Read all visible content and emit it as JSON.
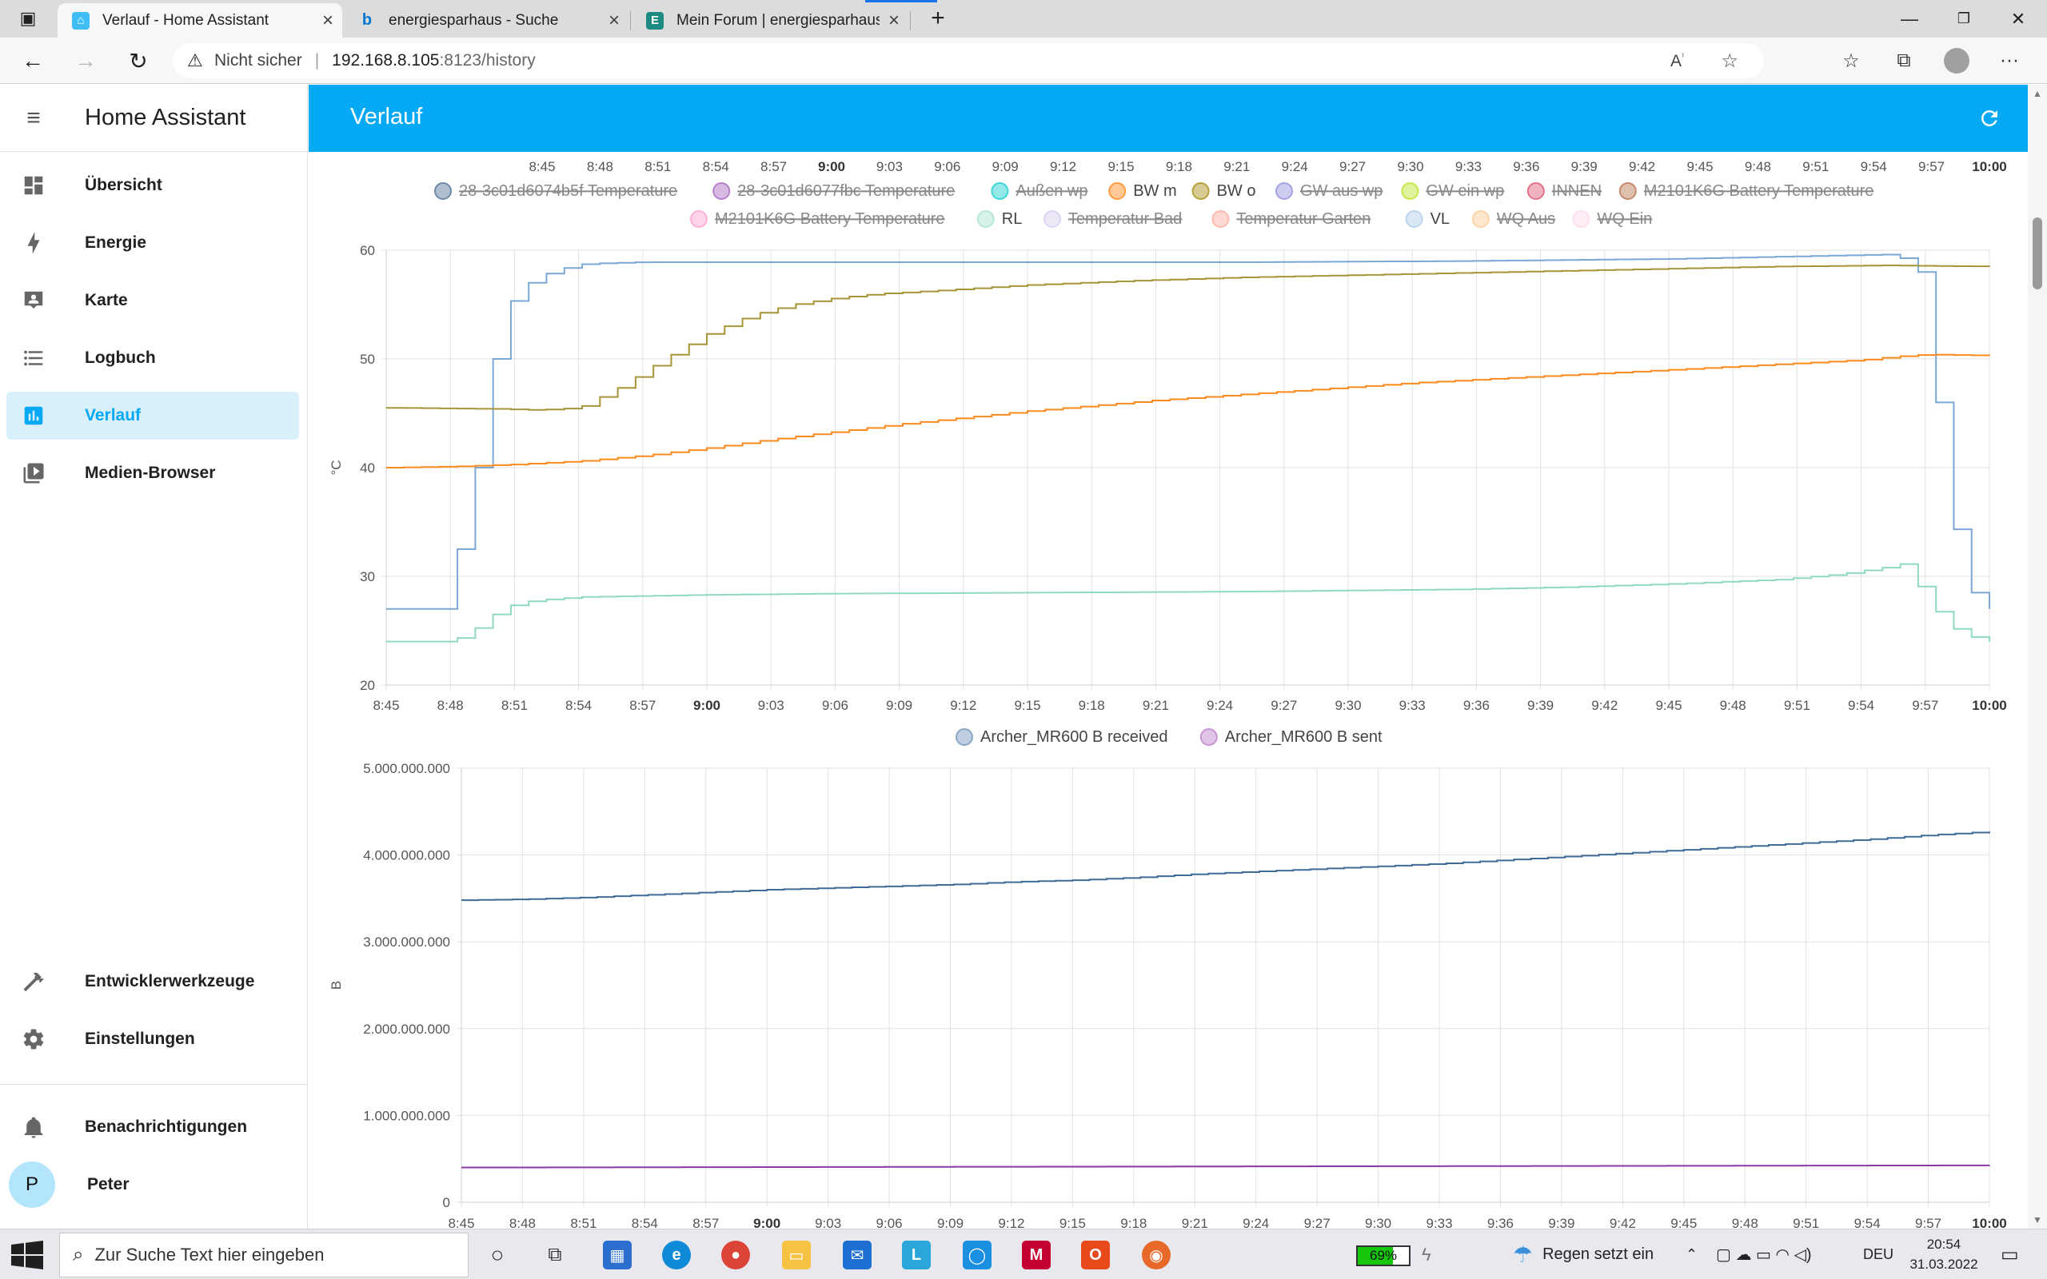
{
  "browser": {
    "tabs": [
      {
        "title": "Verlauf - Home Assistant",
        "icon": "home-assistant-icon",
        "color": "#41bdf5",
        "active": true
      },
      {
        "title": "energiesparhaus - Suche",
        "icon": "bing-icon",
        "color": "#0078d4",
        "active": false
      },
      {
        "title": "Mein Forum | energiesparhaus.at",
        "icon": "forum-e-icon",
        "color": "#1b8a82",
        "active": false
      }
    ],
    "insecure_label": "Nicht sicher",
    "url_host": "192.168.8.105",
    "url_rest": ":8123/history"
  },
  "sidebar": {
    "title": "Home Assistant",
    "items": [
      {
        "label": "Übersicht",
        "icon": "dashboard-icon",
        "selected": false
      },
      {
        "label": "Energie",
        "icon": "lightning-bolt-icon",
        "selected": false
      },
      {
        "label": "Karte",
        "icon": "map-account-icon",
        "selected": false
      },
      {
        "label": "Logbuch",
        "icon": "logbook-list-icon",
        "selected": false
      },
      {
        "label": "Verlauf",
        "icon": "history-chart-icon",
        "selected": true
      },
      {
        "label": "Medien-Browser",
        "icon": "media-play-icon",
        "selected": false
      }
    ],
    "bottom_items": [
      {
        "label": "Entwicklerwerkzeuge",
        "icon": "hammer-icon"
      },
      {
        "label": "Einstellungen",
        "icon": "cog-icon"
      }
    ],
    "notifications_label": "Benachrichtigungen",
    "user": {
      "initial": "P",
      "name": "Peter"
    }
  },
  "header": {
    "title": "Verlauf"
  },
  "chart_data": [
    {
      "type": "line",
      "ylabel": "°C",
      "ylim": [
        20,
        60
      ],
      "yticks": [
        20,
        30,
        40,
        50,
        60
      ],
      "xlim_minutes": [
        0,
        75
      ],
      "x_ticks": [
        "8:45",
        "8:48",
        "8:51",
        "8:54",
        "8:57",
        "9:00",
        "9:03",
        "9:06",
        "9:09",
        "9:12",
        "9:15",
        "9:18",
        "9:21",
        "9:24",
        "9:27",
        "9:30",
        "9:33",
        "9:36",
        "9:39",
        "9:42",
        "9:45",
        "9:48",
        "9:51",
        "9:54",
        "9:57",
        "10:00"
      ],
      "bold_ticks": [
        "9:00",
        "10:00"
      ],
      "legend": [
        {
          "name": "28-3c01d6074b5f Temperature",
          "color": "#6f8aa8",
          "hidden": true
        },
        {
          "name": "28-3c01d6077fbc Temperature",
          "color": "#b77fc9",
          "hidden": true
        },
        {
          "name": "Außen wp",
          "color": "#3ed6d6",
          "hidden": true
        },
        {
          "name": "BW m",
          "color": "#ff9b3d",
          "hidden": false
        },
        {
          "name": "BW o",
          "color": "#b7a13a",
          "hidden": false
        },
        {
          "name": "GW aus wp",
          "color": "#a5a3e3",
          "hidden": true
        },
        {
          "name": "GW ein wp",
          "color": "#c6e84a",
          "hidden": true
        },
        {
          "name": "INNEN",
          "color": "#e3738a",
          "hidden": true
        },
        {
          "name": "M2101K6G Battery Temperature",
          "color": "#c58a6c",
          "hidden": true
        },
        {
          "name": "M2101K6G Battery Temperature",
          "color": "#ffb0d8",
          "hidden": true
        },
        {
          "name": "RL",
          "color": "#b5e8d8",
          "hidden": false
        },
        {
          "name": "Temperatur Bad",
          "color": "#ded6f2",
          "hidden": true
        },
        {
          "name": "Temperatur Garten",
          "color": "#ffb8b0",
          "hidden": true
        },
        {
          "name": "VL",
          "color": "#bcd5ee",
          "hidden": false
        },
        {
          "name": "WQ Aus",
          "color": "#ffd3a8",
          "hidden": true
        },
        {
          "name": "WQ Ein",
          "color": "#ffe0ee",
          "hidden": true
        }
      ],
      "series": [
        {
          "name": "VL",
          "color": "#7aa8d6",
          "x": [
            0,
            2.5,
            3,
            3.5,
            4,
            4.5,
            5,
            5.5,
            6,
            7,
            8,
            9,
            10,
            12,
            15,
            20,
            30,
            40,
            50,
            60,
            65,
            70,
            71.5,
            72,
            72.5,
            73,
            73.5,
            74,
            74.5,
            75
          ],
          "y": [
            27,
            27,
            29.5,
            34,
            38,
            44,
            50,
            54,
            56,
            57.5,
            58.2,
            58.7,
            58.8,
            58.9,
            58.9,
            58.9,
            58.9,
            58.9,
            59,
            59.2,
            59.4,
            59.6,
            59,
            56,
            46,
            37,
            33,
            29,
            27.5,
            27
          ]
        },
        {
          "name": "BW o",
          "color": "#a69437",
          "x": [
            0,
            5,
            7,
            9,
            11,
            13,
            15,
            17,
            19,
            21,
            23,
            25,
            30,
            35,
            40,
            45,
            50,
            55,
            60,
            65,
            70,
            75
          ],
          "y": [
            45.5,
            45.4,
            45.3,
            45.5,
            47.5,
            50,
            52.3,
            54,
            55,
            55.6,
            56,
            56.2,
            56.8,
            57.2,
            57.5,
            57.7,
            57.9,
            58.1,
            58.3,
            58.5,
            58.6,
            58.5
          ]
        },
        {
          "name": "BW m",
          "color": "#fb8a1e",
          "x": [
            0,
            3,
            6,
            9,
            12,
            15,
            18,
            21,
            24,
            27,
            30,
            33,
            36,
            39,
            42,
            45,
            48,
            51,
            54,
            57,
            60,
            63,
            66,
            69,
            70.5,
            72,
            75
          ],
          "y": [
            40,
            40.1,
            40.3,
            40.6,
            41.1,
            41.8,
            42.6,
            43.3,
            44,
            44.6,
            45.2,
            45.7,
            46.2,
            46.6,
            47,
            47.4,
            47.8,
            48.1,
            48.4,
            48.7,
            49,
            49.3,
            49.6,
            49.9,
            50.2,
            50.4,
            50.3
          ]
        },
        {
          "name": "RL",
          "color": "#8fd9c4",
          "x": [
            0,
            3,
            4,
            5,
            6,
            7,
            9,
            12,
            15,
            20,
            30,
            40,
            45,
            50,
            55,
            60,
            65,
            68,
            70,
            71,
            72,
            73,
            74,
            75
          ],
          "y": [
            24,
            24,
            25,
            26.5,
            27.5,
            27.8,
            28.1,
            28.2,
            28.3,
            28.4,
            28.5,
            28.6,
            28.7,
            28.8,
            29,
            29.3,
            29.7,
            30.2,
            30.8,
            31.2,
            28,
            25.5,
            24.5,
            24
          ]
        }
      ]
    },
    {
      "type": "line",
      "ylabel": "B",
      "ylim": [
        0,
        5000000000
      ],
      "ytick_labels": [
        "0",
        "1.000.000.000",
        "2.000.000.000",
        "3.000.000.000",
        "4.000.000.000",
        "5.000.000.000"
      ],
      "xlim_minutes": [
        0,
        75
      ],
      "x_ticks": [
        "8:45",
        "8:48",
        "8:51",
        "8:54",
        "8:57",
        "9:00",
        "9:03",
        "9:06",
        "9:09",
        "9:12",
        "9:15",
        "9:18",
        "9:21",
        "9:24",
        "9:27",
        "9:30",
        "9:33",
        "9:36",
        "9:39",
        "9:42",
        "9:45",
        "9:48",
        "9:51",
        "9:54",
        "9:57",
        "10:00"
      ],
      "bold_ticks": [
        "9:00",
        "10:00"
      ],
      "legend": [
        {
          "name": "Archer_MR600 B received",
          "color": "#8ba7c8",
          "hidden": false
        },
        {
          "name": "Archer_MR600 B sent",
          "color": "#c793d3",
          "hidden": false
        }
      ],
      "series": [
        {
          "name": "Archer_MR600 B received",
          "color": "#3f6b97",
          "x": [
            0,
            3,
            6,
            9,
            12,
            15,
            18,
            21,
            24,
            27,
            30,
            33,
            36,
            39,
            42,
            45,
            48,
            51,
            54,
            57,
            60,
            63,
            66,
            69,
            72,
            75
          ],
          "y": [
            3480000000,
            3490000000,
            3510000000,
            3540000000,
            3570000000,
            3600000000,
            3620000000,
            3640000000,
            3660000000,
            3690000000,
            3710000000,
            3740000000,
            3780000000,
            3810000000,
            3840000000,
            3870000000,
            3900000000,
            3940000000,
            3980000000,
            4020000000,
            4060000000,
            4100000000,
            4140000000,
            4180000000,
            4230000000,
            4270000000
          ]
        },
        {
          "name": "Archer_MR600 B sent",
          "color": "#8b39a3",
          "x": [
            0,
            15,
            30,
            45,
            60,
            75
          ],
          "y": [
            400000000,
            405000000,
            410000000,
            415000000,
            420000000,
            425000000
          ]
        }
      ]
    }
  ],
  "taskbar": {
    "search_placeholder": "Zur Suche Text hier eingeben",
    "battery_percent": 69,
    "battery_label": "69%",
    "weather_text": "Regen setzt ein",
    "language": "DEU",
    "time": "20:54",
    "date": "31.03.2022"
  }
}
